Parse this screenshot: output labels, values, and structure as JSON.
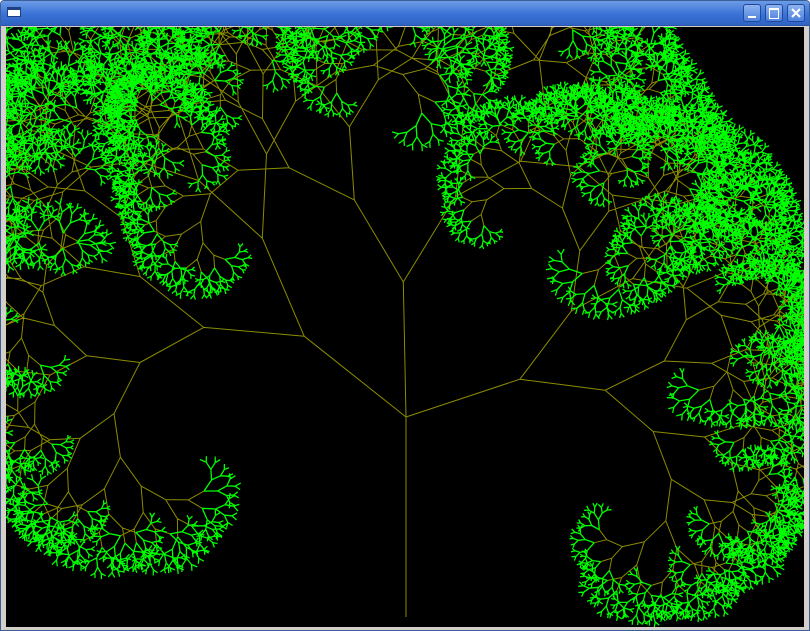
{
  "window": {
    "title": "",
    "icon": "window-icon",
    "controls": {
      "minimize_icon": "minimize-icon",
      "maximize_icon": "maximize-icon",
      "close_icon": "close-icon"
    }
  },
  "canvas": {
    "background": "#000000",
    "branch_color": "#8c8c00",
    "leaf_color": "#00ff00",
    "picture": "fractal-tree"
  }
}
